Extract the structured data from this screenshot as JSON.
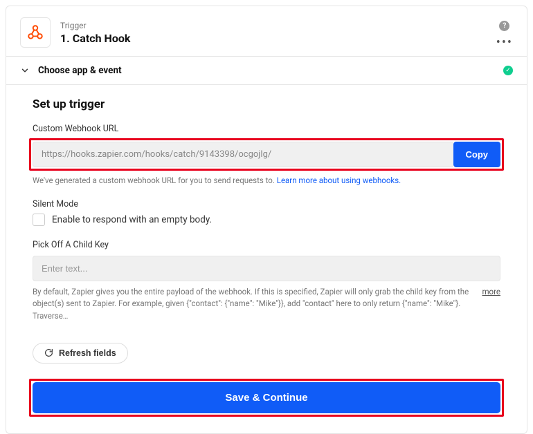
{
  "header": {
    "subtitle": "Trigger",
    "title": "1. Catch Hook"
  },
  "section": {
    "choose_label": "Choose app & event"
  },
  "setup": {
    "title": "Set up trigger",
    "webhook": {
      "label": "Custom Webhook URL",
      "url": "https://hooks.zapier.com/hooks/catch/9143398/ocgojlg/",
      "copy_label": "Copy",
      "helper_prefix": "We've generated a custom webhook URL for you to send requests to. ",
      "helper_link": "Learn more about using webhooks."
    },
    "silent": {
      "label": "Silent Mode",
      "checkbox_label": "Enable to respond with an empty body."
    },
    "childkey": {
      "label": "Pick Off A Child Key",
      "placeholder": "Enter text...",
      "helper": "By default, Zapier gives you the entire payload of the webhook. If this is specified, Zapier will only grab the child key from the object(s) sent to Zapier. For example, given {\"contact\": {\"name\": \"Mike\"}}, add \"contact\" here to only return {\"name\": \"Mike\"}. Traverse…",
      "more": "more"
    },
    "refresh_label": "Refresh fields",
    "save_label": "Save & Continue"
  }
}
